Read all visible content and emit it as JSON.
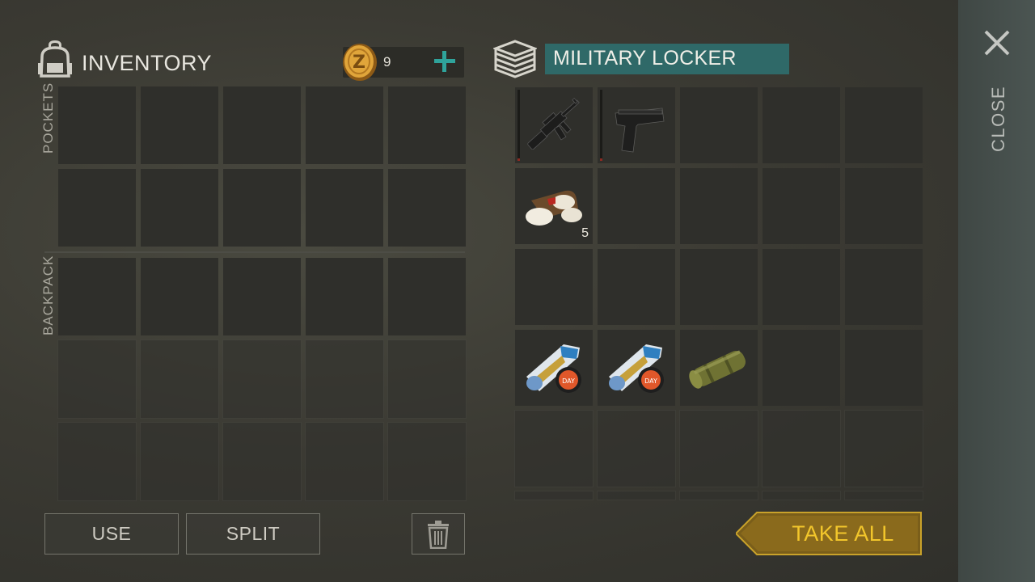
{
  "inventory": {
    "title": "INVENTORY",
    "coins": "9",
    "pockets_label": "POCKETS",
    "backpack_label": "BACKPACK"
  },
  "container": {
    "title": "MILITARY LOCKER"
  },
  "close_label": "CLOSE",
  "locker_items": [
    {
      "slot": 0,
      "icon": "assault-rifle-icon",
      "durability": 0.03
    },
    {
      "slot": 1,
      "icon": "pistol-icon",
      "durability": 0.03
    },
    {
      "slot": 5,
      "icon": "bandage-icon",
      "quantity": "5"
    },
    {
      "slot": 15,
      "icon": "magazine-bundle-icon"
    },
    {
      "slot": 16,
      "icon": "magazine-bundle-icon"
    },
    {
      "slot": 17,
      "icon": "cylinder-canister-icon"
    }
  ],
  "buttons": {
    "use": "USE",
    "split": "SPLIT",
    "trash_icon": "trash-icon",
    "take_all": "TAKE ALL"
  },
  "colors": {
    "accent_teal": "#2f6968",
    "plus_teal": "#2fa39b",
    "take_all_gold": "#c9a22a",
    "take_all_text": "#f2c62b",
    "durability_red": "#8c2a22"
  }
}
